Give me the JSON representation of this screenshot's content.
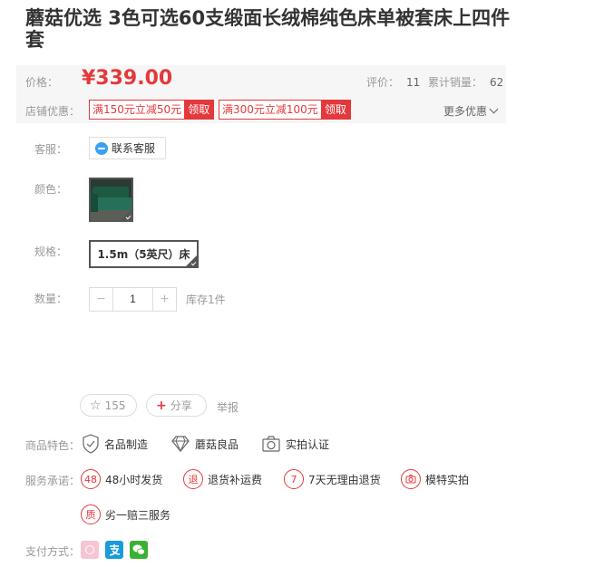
{
  "product": {
    "title": "蘑菇优选 3色可选60支缎面长绒棉纯色床单被套床上四件套"
  },
  "price_box": {
    "price_label": "价格：",
    "price": "¥339.00",
    "rating_label": "评价：",
    "rating_value": "11",
    "sales_label": "累计销量：",
    "sales_value": "62",
    "promo_label": "店铺优惠：",
    "coupons": [
      {
        "text": "满150元立减50元",
        "button": "领取"
      },
      {
        "text": "满300元立减100元",
        "button": "领取"
      }
    ],
    "more_promos": "更多优惠"
  },
  "options": {
    "service_label": "客服：",
    "service_button": "联系客服",
    "color_label": "颜色：",
    "spec_label": "规格：",
    "spec_value": "1.5m（5英尺）床",
    "qty_label": "数量：",
    "qty_minus": "−",
    "qty_value": "1",
    "qty_plus": "+",
    "stock": "库存1件"
  },
  "actions": {
    "favorites_count": "155",
    "share": "分享",
    "report": "举报"
  },
  "features": {
    "label": "商品特色：",
    "items": [
      "名品制造",
      "蘑菇良品",
      "实拍认证"
    ]
  },
  "services": {
    "label": "服务承诺：",
    "items": [
      {
        "badge": "48",
        "text": "48小时发货"
      },
      {
        "badge": "退",
        "text": "退货补运费"
      },
      {
        "badge": "7",
        "text": "7天无理由退货"
      },
      {
        "badge": "",
        "text": "模特实拍"
      },
      {
        "badge": "质",
        "text": "劣一赔三服务"
      }
    ]
  },
  "payment": {
    "label": "支付方式：",
    "icons": [
      "mogu-pay-icon",
      "alipay-icon",
      "wechat-pay-icon"
    ]
  },
  "colors": {
    "accent": "#e4393c",
    "label_gray": "#999999",
    "price_bg": "#f6f6f6"
  }
}
